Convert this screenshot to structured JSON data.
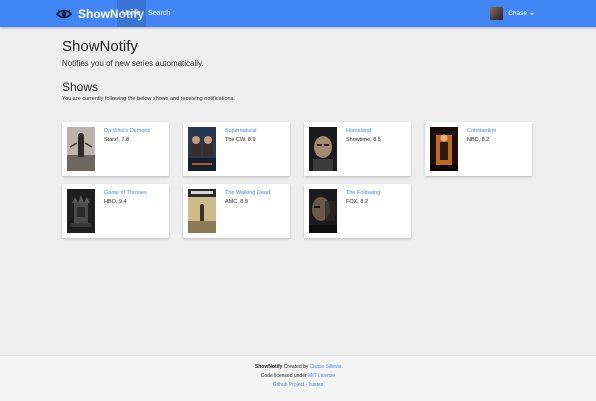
{
  "navbar": {
    "brand": "ShowNotify",
    "links": [
      {
        "label": "Home",
        "active": true
      },
      {
        "label": "Search",
        "active": false
      }
    ],
    "user": {
      "name": "Chase"
    },
    "background": "#4285f4"
  },
  "header": {
    "title": "ShowNotify",
    "subtitle": "Notifies you of new series automatically."
  },
  "shows_section": {
    "title": "Shows",
    "description": "You are currently following the below shows and receiving notifications."
  },
  "shows": [
    {
      "title": "Da Vinci's Demons",
      "info": "Starz!, 7.8",
      "poster_icon": "da-vinci-poster"
    },
    {
      "title": "Supernatural",
      "info": "The CW, 8.9",
      "poster_icon": "supernatural-poster"
    },
    {
      "title": "Homeland",
      "info": "Showtime, 8.5",
      "poster_icon": "homeland-poster"
    },
    {
      "title": "Constantine",
      "info": "NBC, 8.2",
      "poster_icon": "constantine-poster"
    },
    {
      "title": "Game of Thrones",
      "info": "HBO, 9.4",
      "poster_icon": "game-of-thrones-poster"
    },
    {
      "title": "The Walking Dead",
      "info": "AMC, 8.9",
      "poster_icon": "walking-dead-poster"
    },
    {
      "title": "The Following",
      "info": "FOX, 8.2",
      "poster_icon": "following-poster"
    }
  ],
  "footer": {
    "brand": "ShowNotify",
    "created_by_text": "Created by",
    "author": "Chase Sillevis",
    "license_text": "Code licensed under",
    "license_link": "MIT License",
    "github_link": "Github Project",
    "separator": "-",
    "issues_link": "Issues"
  },
  "colors": {
    "accent": "#4285f4",
    "page_background": "#eeeeee"
  }
}
